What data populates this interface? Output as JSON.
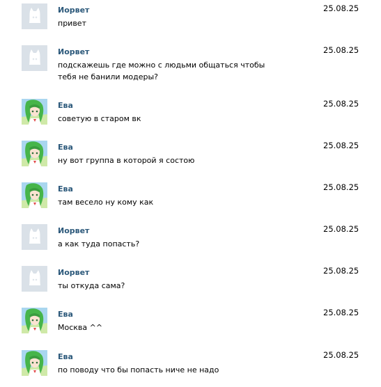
{
  "messages": [
    {
      "author": "Иорвет",
      "avatar": "deactivated-dog-avatar",
      "date": "25.08.25",
      "text": "привет"
    },
    {
      "author": "Иорвет",
      "avatar": "deactivated-dog-avatar",
      "date": "25.08.25",
      "text": "подскажешь где можно с людьми общаться чтобы тебя не банили модеры?"
    },
    {
      "author": "Ева",
      "avatar": "anime-girl-avatar",
      "date": "25.08.25",
      "text": "советую в старом вк"
    },
    {
      "author": "Ева",
      "avatar": "anime-girl-avatar",
      "date": "25.08.25",
      "text": "ну вот группа в которой я состою"
    },
    {
      "author": "Ева",
      "avatar": "anime-girl-avatar",
      "date": "25.08.25",
      "text": "там весело ну кому как"
    },
    {
      "author": "Иорвет",
      "avatar": "deactivated-dog-avatar",
      "date": "25.08.25",
      "text": "а как туда попасть?"
    },
    {
      "author": "Иорвет",
      "avatar": "deactivated-dog-avatar",
      "date": "25.08.25",
      "text": "ты откуда сама?"
    },
    {
      "author": "Ева",
      "avatar": "anime-girl-avatar",
      "date": "25.08.25",
      "text": "Москва ^^"
    },
    {
      "author": "Ева",
      "avatar": "anime-girl-avatar",
      "date": "25.08.25",
      "text": "по поводу что бы попасть ниче не надо"
    }
  ],
  "colors": {
    "author_link": "#2b587a",
    "avatar_placeholder_bg": "#dae1e8"
  }
}
